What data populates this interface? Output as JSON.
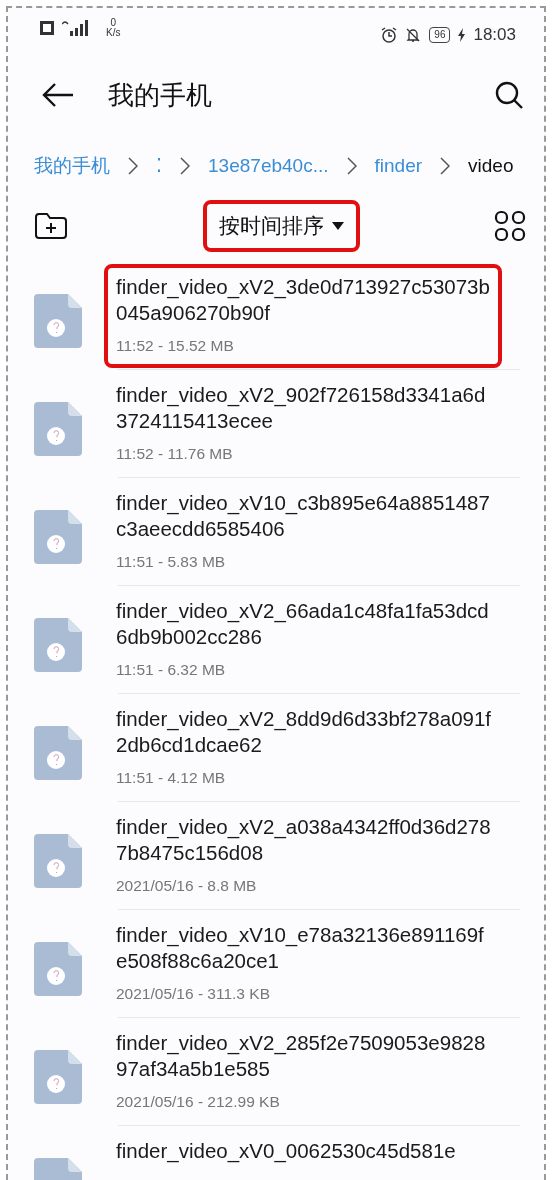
{
  "status_bar": {
    "network_speed": [
      "0",
      "K/s"
    ],
    "battery": "96",
    "time": "18:03"
  },
  "header": {
    "title": "我的手机"
  },
  "breadcrumb": [
    {
      "label": "我的手机",
      "current": false
    },
    {
      "label": "⁚",
      "current": false
    },
    {
      "label": "13e87eb40c...",
      "current": false
    },
    {
      "label": "finder",
      "current": false
    },
    {
      "label": "video",
      "current": true
    }
  ],
  "toolbar": {
    "sort": {
      "label": "按时间排序",
      "highlighted": true
    }
  },
  "files": [
    {
      "name": "finder_video_xV2_3de0d713927c53073b045a906270b90f",
      "meta": "11:52 - 15.52 MB",
      "highlighted": true
    },
    {
      "name": "finder_video_xV2_902f726158d3341a6d3724115413ecee",
      "meta": "11:52 - 11.76 MB",
      "highlighted": false
    },
    {
      "name": "finder_video_xV10_c3b895e64a8851487c3aeecdd6585406",
      "meta": "11:51 - 5.83 MB",
      "highlighted": false
    },
    {
      "name": "finder_video_xV2_66ada1c48fa1fa53dcd6db9b002cc286",
      "meta": "11:51 - 6.32 MB",
      "highlighted": false
    },
    {
      "name": "finder_video_xV2_8dd9d6d33bf278a091f2db6cd1dcae62",
      "meta": "11:51 - 4.12 MB",
      "highlighted": false
    },
    {
      "name": "finder_video_xV2_a038a4342ff0d36d2787b8475c156d08",
      "meta": "2021/05/16 - 8.8 MB",
      "highlighted": false
    },
    {
      "name": "finder_video_xV10_e78a32136e891169fe508f88c6a20ce1",
      "meta": "2021/05/16 - 311.3 KB",
      "highlighted": false
    },
    {
      "name": "finder_video_xV2_285f2e7509053e982897af34a5b1e585",
      "meta": "2021/05/16 - 212.99 KB",
      "highlighted": false
    },
    {
      "name": "finder_video_xV0_0062530c45d581e",
      "highlighted": false
    }
  ]
}
